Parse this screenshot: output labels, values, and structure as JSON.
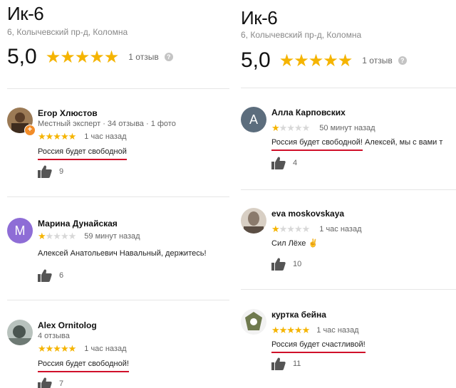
{
  "colors": {
    "star": "#f5b400",
    "star_empty": "#d8d8d8",
    "underline": "#d0102a",
    "avatar_m": "#8e6dd6",
    "avatar_a": "#5c6d7d"
  },
  "left": {
    "title": "Ик-6",
    "address": "6, Колычевский пр-д, Коломна",
    "rating": "5,0",
    "reviews_count": "1 отзыв",
    "help": "?",
    "reviews": [
      {
        "name": "Егор Хлюстов",
        "meta": "Местный эксперт · 34 отзыва · 1 фото",
        "stars": 5,
        "time": "1 час назад",
        "text": "Россия будет свободной",
        "likes": "9",
        "badge": "+"
      },
      {
        "name": "Марина Дунайская",
        "avatar_letter": "М",
        "stars": 1,
        "time": "59 минут назад",
        "text": "Алексей Анатольевич Навальный, держитесь!",
        "likes": "6"
      },
      {
        "name": "Alex Ornitolog",
        "meta": "4 отзыва",
        "stars": 5,
        "time": "1 час назад",
        "text": "Россия будет свободной!",
        "likes": "7"
      }
    ]
  },
  "right": {
    "title": "Ик-6",
    "address": "6, Колычевский пр-д, Коломна",
    "rating": "5,0",
    "reviews_count": "1 отзыв",
    "help": "?",
    "reviews": [
      {
        "name": "Алла Карповских",
        "avatar_letter": "А",
        "stars": 1,
        "time": "50 минут назад",
        "text_underlined": "Россия будет свободной!",
        "text_rest": " Алексей, мы с вами т",
        "likes": "4"
      },
      {
        "name": "eva moskovskaya",
        "stars": 1,
        "time": "1 час назад",
        "text": "Сил Лёхе ✌",
        "likes": "10"
      },
      {
        "name": "куртка бейна",
        "stars": 5,
        "time": "1 час назад",
        "text": "Россия будет счастливой!",
        "likes": "11"
      }
    ]
  }
}
